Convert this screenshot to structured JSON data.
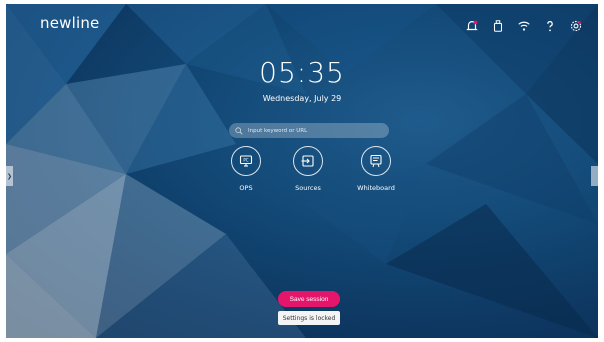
{
  "brand": {
    "logo_text": "newline"
  },
  "status_icons": [
    "notification-bell-icon",
    "usb-drive-icon",
    "wifi-icon",
    "help-icon",
    "settings-gear-icon"
  ],
  "clock": {
    "time": "05:35",
    "date": "Wednesday, July 29"
  },
  "search": {
    "placeholder": "Input keyword or URL"
  },
  "apps": [
    {
      "label": "OPS",
      "icon": "pc-icon"
    },
    {
      "label": "Sources",
      "icon": "sources-input-icon"
    },
    {
      "label": "Whiteboard",
      "icon": "whiteboard-icon"
    }
  ],
  "session": {
    "save_label": "Save session",
    "locked_label": "Settings is locked"
  },
  "colors": {
    "accent": "#e4166b",
    "notification_dot": "#e4166b",
    "background": "#134a78"
  }
}
